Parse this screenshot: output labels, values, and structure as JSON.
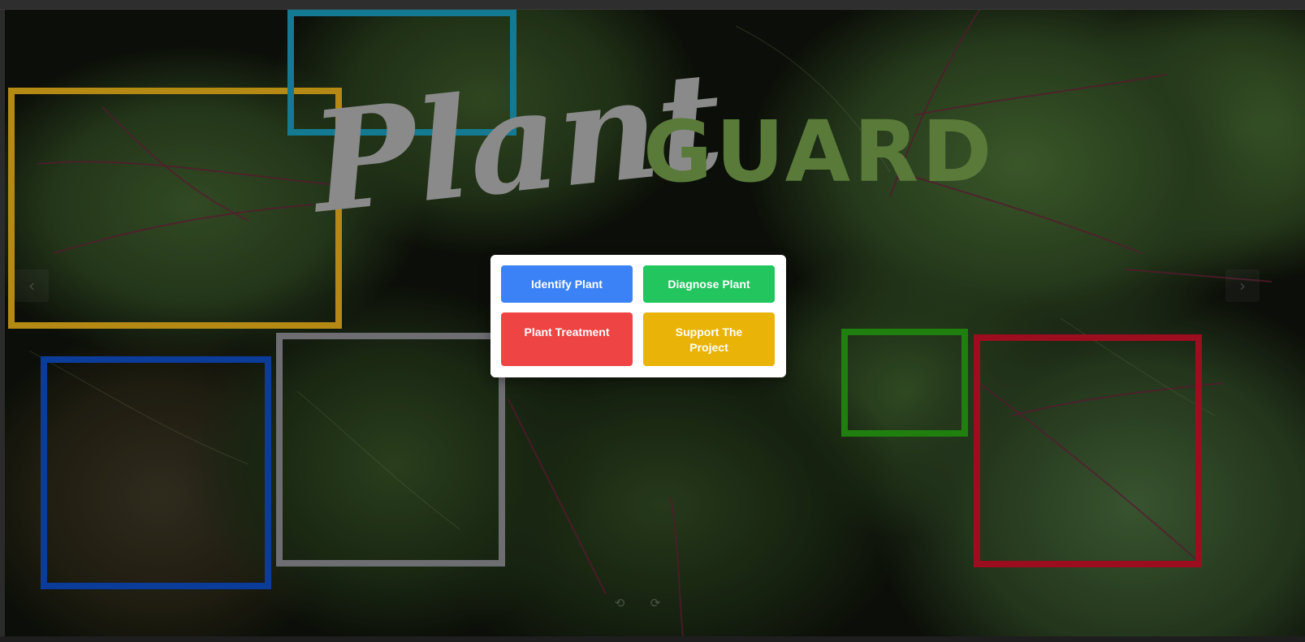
{
  "brand": {
    "script_part": "Plant",
    "bold_part": "GUARD"
  },
  "actions": {
    "identify_label": "Identify Plant",
    "diagnose_label": "Diagnose Plant",
    "treatment_label": "Plant Treatment",
    "support_label": "Support The Project"
  },
  "carousel": {
    "prev_glyph": "‹",
    "next_glyph": "›",
    "rotate_left_glyph": "⟲",
    "rotate_right_glyph": "⟳"
  },
  "colors": {
    "identify": "#3b82f6",
    "diagnose": "#22c55e",
    "treatment": "#ef4444",
    "support": "#eab308",
    "guard_text": "#5a7a3a",
    "script_text": "#8a8a8a"
  },
  "annotation_box_colors": [
    "#b48a14",
    "#137a92",
    "#0b3c9a",
    "#6e6e72",
    "#1f7f0f",
    "#9c0d1f"
  ]
}
